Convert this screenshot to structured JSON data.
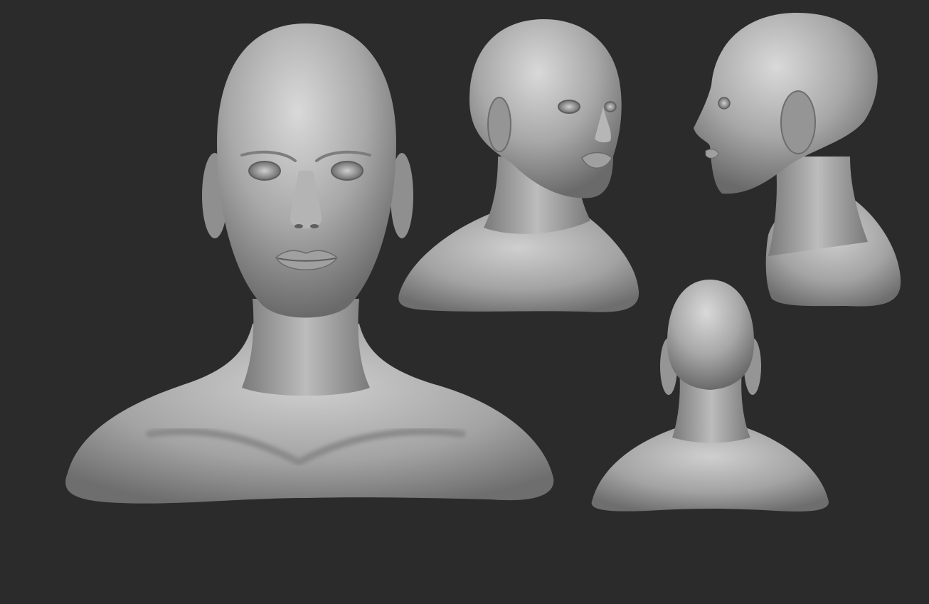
{
  "scene": {
    "background": "#2b2b2b",
    "material": {
      "highlight": "#d8d8d8",
      "mid": "#a9a9a9",
      "shadow": "#6c6c6c",
      "deep": "#454545"
    },
    "views": [
      {
        "id": "front",
        "label_semantic": "front-view-bust"
      },
      {
        "id": "three-quarter",
        "label_semantic": "three-quarter-view-bust"
      },
      {
        "id": "side",
        "label_semantic": "side-profile-bust"
      },
      {
        "id": "back",
        "label_semantic": "back-view-bust"
      }
    ]
  }
}
